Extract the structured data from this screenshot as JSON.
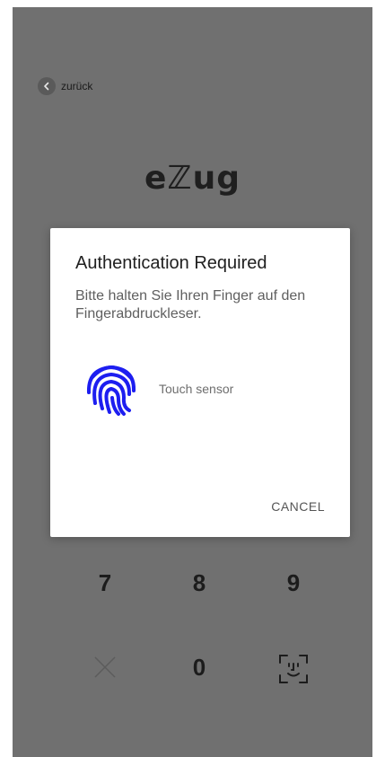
{
  "header": {
    "back_label": "zurück"
  },
  "logo": {
    "text": "eℤug"
  },
  "dialog": {
    "title": "Authentication Required",
    "message": "Bitte halten Sie Ihren Finger auf den Fingerabdruckleser.",
    "sensor_label": "Touch sensor",
    "cancel_label": "CANCEL",
    "fingerprint_color": "#1d1ef0"
  },
  "keypad": {
    "keys": [
      "7",
      "8",
      "9",
      "0"
    ],
    "delete_icon": "close-icon",
    "face_icon": "face-id-icon"
  },
  "colors": {
    "scrim": "#707070",
    "dialog_bg": "#ffffff"
  }
}
